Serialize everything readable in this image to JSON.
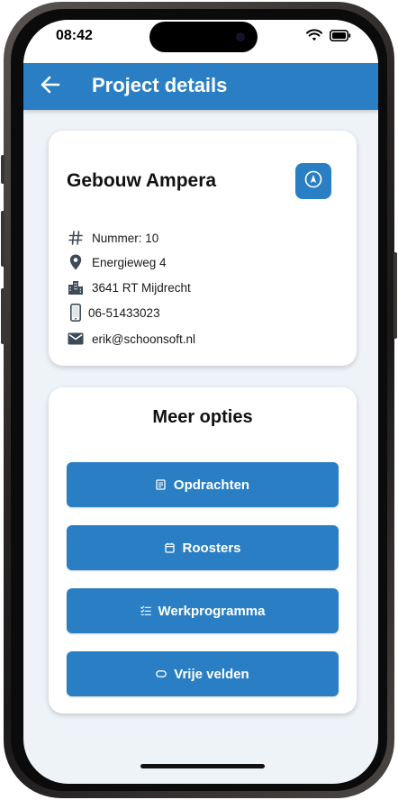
{
  "status_bar": {
    "time": "08:42",
    "icons": [
      "wifi-icon",
      "battery-icon"
    ]
  },
  "app_bar": {
    "back_icon": "arrow-left-icon",
    "title": "Project details",
    "background": "#2a7fc4"
  },
  "project": {
    "name": "Gebouw Ampera",
    "navigate_icon": "navigation-icon",
    "details": [
      {
        "icon": "hash-icon",
        "text": "Nummer: 10"
      },
      {
        "icon": "location-pin-icon",
        "text": "Energieweg 4"
      },
      {
        "icon": "city-icon",
        "text": "3641 RT Mijdrecht"
      },
      {
        "icon": "phone-icon",
        "text": "06-51433023"
      },
      {
        "icon": "email-icon",
        "text": "erik@schoonsoft.nl"
      }
    ]
  },
  "more_options": {
    "title": "Meer opties",
    "buttons": [
      {
        "icon": "clipboard-icon",
        "label": "Opdrachten"
      },
      {
        "icon": "calendar-icon",
        "label": "Roosters"
      },
      {
        "icon": "checklist-icon",
        "label": "Werkprogramma"
      },
      {
        "icon": "tag-icon",
        "label": "Vrije velden"
      }
    ]
  },
  "colors": {
    "primary": "#2a7fc4",
    "background": "#eef3f8",
    "card": "#ffffff"
  }
}
